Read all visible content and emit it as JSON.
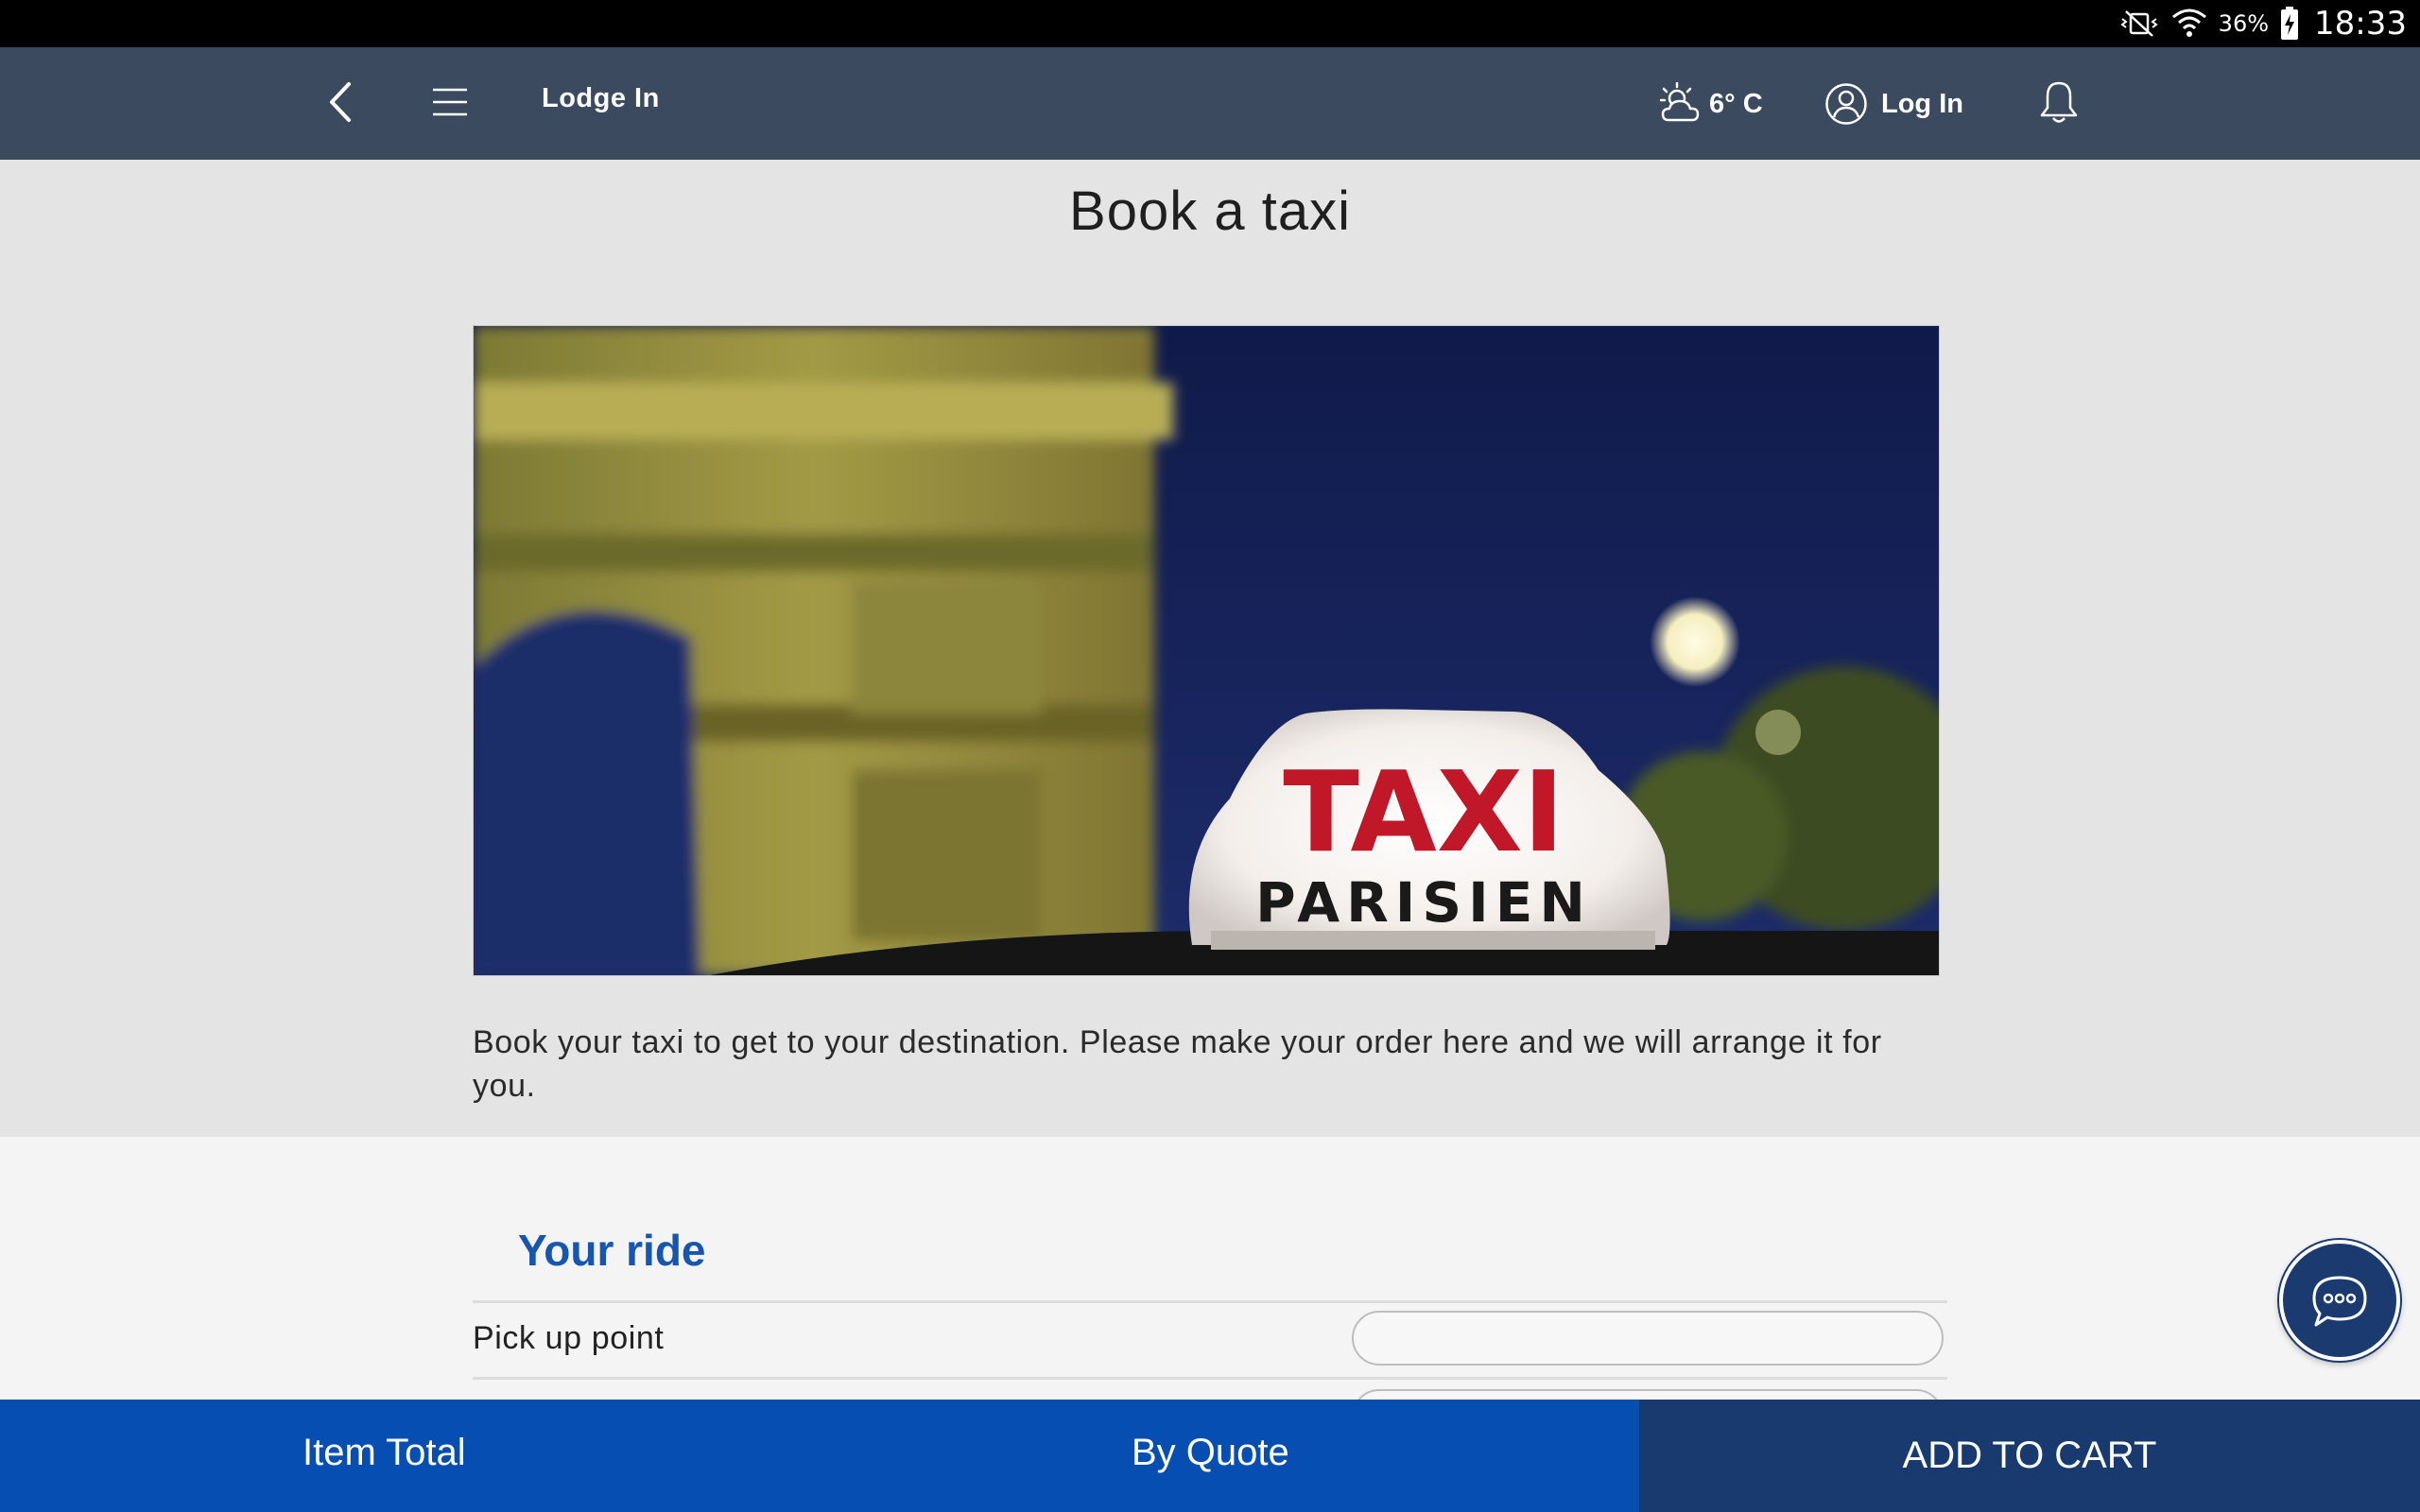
{
  "status_bar": {
    "battery_percent": "36%",
    "time": "18:33"
  },
  "header": {
    "title": "Lodge In",
    "weather": "6° C",
    "login_label": "Log In"
  },
  "page": {
    "title": "Book a taxi",
    "hero_sign_line1": "TAXI",
    "hero_sign_line2": "PARISIEN",
    "intro": "Book your taxi to get to your destination. Please make your order here and we will arrange it for you."
  },
  "form": {
    "section_title": "Your ride",
    "pickup_label": "Pick up point",
    "pickup_value": ""
  },
  "footer": {
    "item_total_label": "Item Total",
    "price_label": "By Quote",
    "add_to_cart_label": "ADD TO CART"
  },
  "colors": {
    "header_bg": "#3b4a5e",
    "accent_blue": "#064eb2",
    "cart_bg": "#193a6f",
    "section_title": "#1756b0"
  }
}
